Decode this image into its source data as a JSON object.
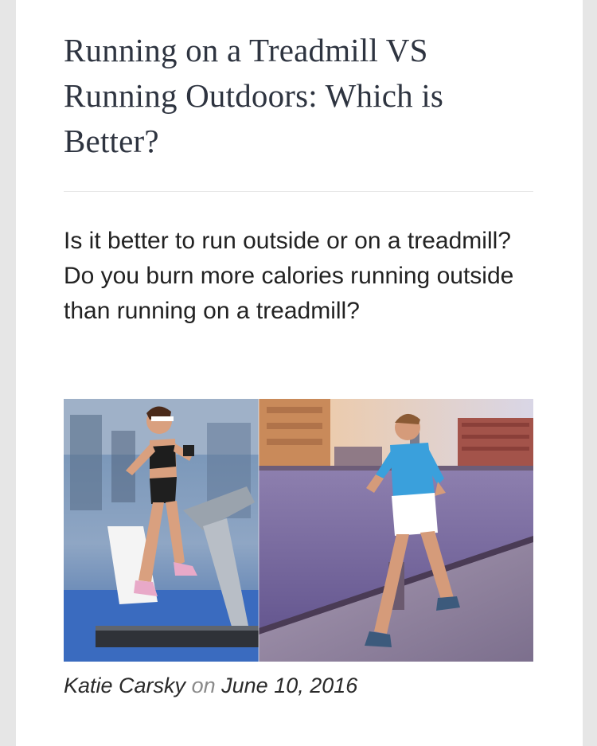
{
  "post": {
    "title": "Running on a Treadmill VS Running Outdoors: Which is Better?",
    "excerpt": "Is it better to run outside or on a treadmill? Do you burn more calories running outside than running on a treadmill?",
    "author": "Katie Carsky",
    "on_word": "on",
    "date": "June 10, 2016"
  },
  "image": {
    "left_panel": "woman running on treadmill in gym",
    "right_panel": "man running outdoors along waterfront boardwalk"
  }
}
